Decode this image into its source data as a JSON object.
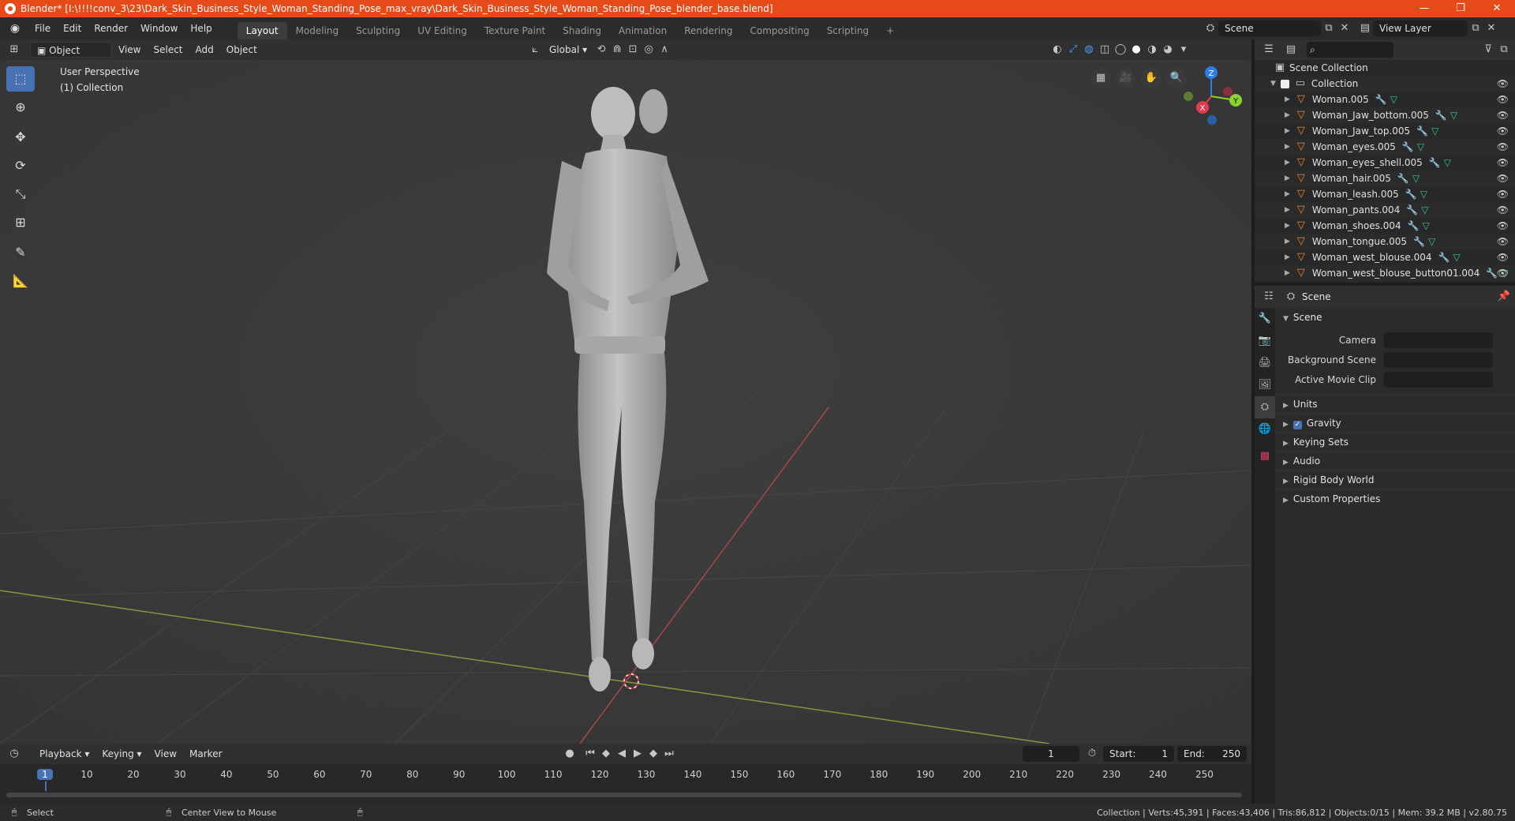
{
  "title_bar": {
    "title": "Blender* [I:\\!!!!conv_3\\23\\Dark_Skin_Business_Style_Woman_Standing_Pose_max_vray\\Dark_Skin_Business_Style_Woman_Standing_Pose_blender_base.blend]",
    "controls": [
      "—",
      "❐",
      "✕"
    ]
  },
  "menu": [
    "File",
    "Edit",
    "Render",
    "Window",
    "Help"
  ],
  "workspaces": [
    {
      "label": "Layout",
      "active": true
    },
    {
      "label": "Modeling"
    },
    {
      "label": "Sculpting"
    },
    {
      "label": "UV Editing"
    },
    {
      "label": "Texture Paint"
    },
    {
      "label": "Shading"
    },
    {
      "label": "Animation"
    },
    {
      "label": "Rendering"
    },
    {
      "label": "Compositing"
    },
    {
      "label": "Scripting"
    }
  ],
  "add_workspace": "+",
  "scene_selector": "Scene",
  "view_layer_selector": "View Layer",
  "viewport_header": {
    "mode": "Object Mode",
    "menus": [
      "View",
      "Select",
      "Add",
      "Object"
    ],
    "transform_orientation": "Global"
  },
  "viewport": {
    "view_name": "User Perspective",
    "collection": "(1) Collection",
    "gizmo": {
      "x": "X",
      "y": "Y",
      "z": "Z"
    }
  },
  "outliner": {
    "search_placeholder": "",
    "root": "Scene Collection",
    "collection": "Collection",
    "objects": [
      "Woman.005",
      "Woman_Jaw_bottom.005",
      "Woman_Jaw_top.005",
      "Woman_eyes.005",
      "Woman_eyes_shell.005",
      "Woman_hair.005",
      "Woman_leash.005",
      "Woman_pants.004",
      "Woman_shoes.004",
      "Woman_tongue.005",
      "Woman_west_blouse.004",
      "Woman_west_blouse_button01.004"
    ]
  },
  "properties": {
    "header_title": "Scene",
    "panel_title": "Scene",
    "fields": [
      {
        "label": "Camera"
      },
      {
        "label": "Background Scene"
      },
      {
        "label": "Active Movie Clip"
      }
    ],
    "subpanels": [
      "Units",
      "Gravity",
      "Keying Sets",
      "Audio",
      "Rigid Body World",
      "Custom Properties"
    ]
  },
  "timeline": {
    "menus": [
      "Playback",
      "Keying",
      "View",
      "Marker"
    ],
    "current_frame": "1",
    "start_label": "Start:",
    "start": "1",
    "end_label": "End:",
    "end": "250",
    "ruler": [
      "1",
      "10",
      "20",
      "30",
      "40",
      "50",
      "60",
      "70",
      "80",
      "90",
      "100",
      "110",
      "120",
      "130",
      "140",
      "150",
      "160",
      "170",
      "180",
      "190",
      "200",
      "210",
      "220",
      "230",
      "240",
      "250"
    ]
  },
  "status_bar": {
    "left_action": "Select",
    "middle_action": "Center View to Mouse",
    "stats": "Collection | Verts:45,391 | Faces:43,406 | Tris:86,812 | Objects:0/15 | Mem: 39.2 MB | v2.80.75"
  },
  "colors": {
    "title_bar": "#e64a19",
    "accent": "#4772b3",
    "mesh_icon": "#e8893b",
    "x_axis": "#e6394e",
    "y_axis": "#8bd12f",
    "z_axis": "#2e7de6"
  }
}
